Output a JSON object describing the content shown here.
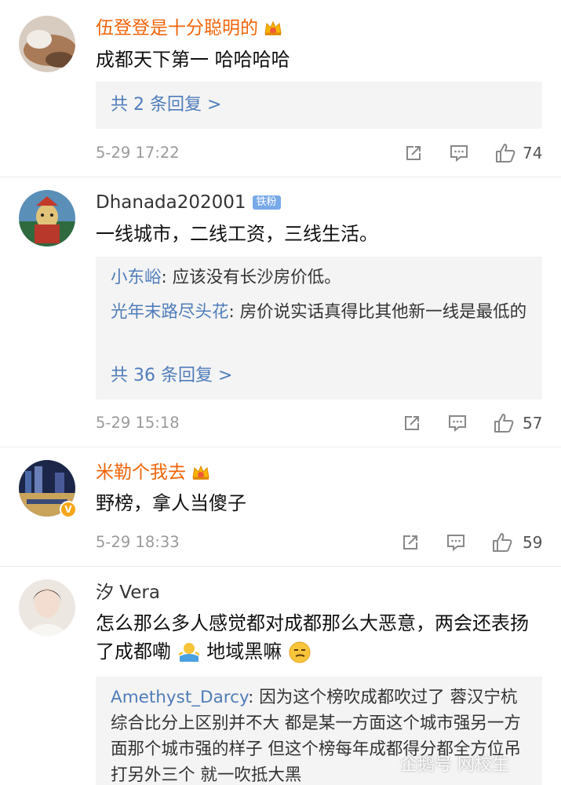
{
  "comments": [
    {
      "username": "伍登登是十分聪明的",
      "text": "成都天下第一 哈哈哈哈",
      "reply_more": "共 2 条回复 >",
      "time": "5-29 17:22",
      "likes": "74"
    },
    {
      "username": "Dhanada202001",
      "badge": "铁粉",
      "text": "一线城市，二线工资，三线生活。",
      "replies": [
        {
          "user": "小东峪",
          "text": ": 应该没有长沙房价低。"
        },
        {
          "user": "光年末路尽头花",
          "text": ": 房价说实话真得比其他新一线是最低的"
        }
      ],
      "reply_more": "共 36 条回复 >",
      "time": "5-29 15:18",
      "likes": "57"
    },
    {
      "username": "米勒个我去",
      "text": "野榜，拿人当傻子",
      "time": "5-29 18:33",
      "likes": "59"
    },
    {
      "username": "汐 Vera",
      "text_a": "怎么那么多人感觉都对成都那么大恶意，两会还表扬了成都嘞",
      "text_b": "地域黑嘛",
      "replies": [
        {
          "user": "Amethyst_Darcy",
          "text": ": 因为这个榜吹成都吹过了 蓉汉宁杭综合比分上区别并不大 都是某一方面这个城市强另一方面那个城市强的样子 但这个榜每年成都得分都全方位吊打另外三个 就一吹抵大黑"
        }
      ]
    }
  ],
  "watermark": "企鹅号 网校生",
  "colors": {
    "vip_name": "#f0640a",
    "reply_user": "#4f7dba",
    "fan_badge": "#78a9e8",
    "vip_badge": "#f7a61a"
  },
  "icons": [
    "crown-icon",
    "repost-icon",
    "comment-icon",
    "like-icon",
    "verified-v-icon",
    "emoji-icon"
  ]
}
